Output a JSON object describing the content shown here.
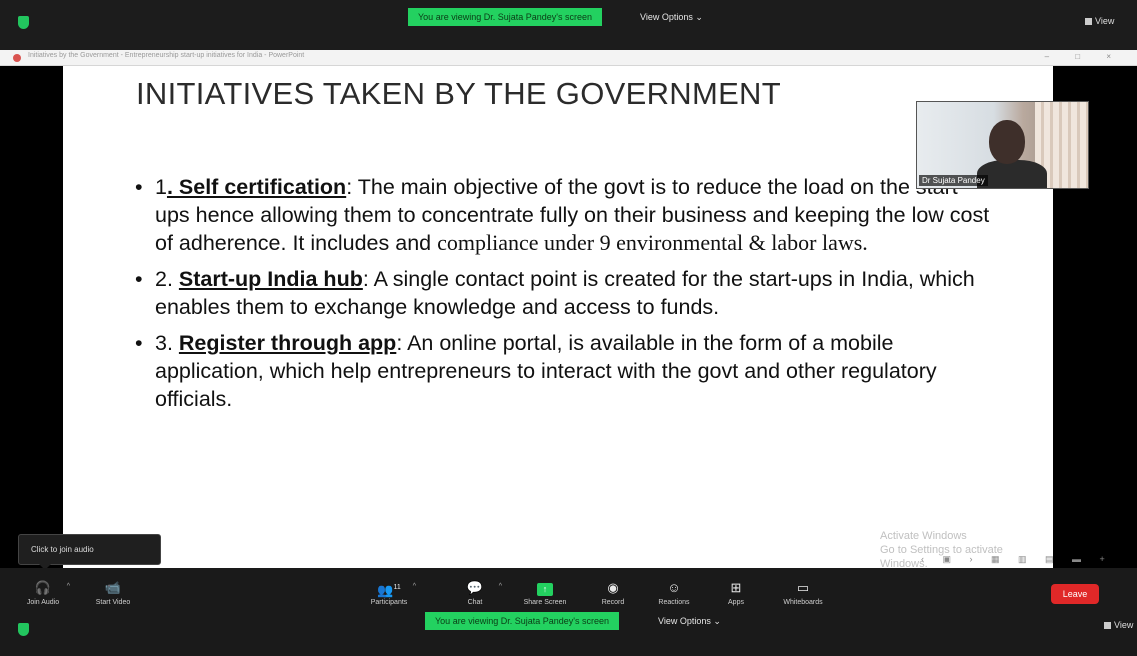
{
  "colors": {
    "accent_green": "#23d160",
    "leave_red": "#e02828",
    "toolbar_bg": "#1a1a1a"
  },
  "top_bar": {
    "security_icon": "shield-icon",
    "viewing_banner": "You are viewing Dr. Sujata Pandey's screen",
    "view_options": "View Options ⌄",
    "view_button": "View"
  },
  "browser": {
    "tab_title": "Initiatives by the Government - Entrepreneurship start-up initiatives for India - PowerPoint",
    "controls": "– □ ×"
  },
  "slide": {
    "title": "INITIATIVES TAKEN BY THE GOVERNMENT",
    "bullets": [
      {
        "num": "1",
        "term": ". Self certification",
        "text": ": The main objective of the govt is to reduce the load on the start ups hence allowing them to concentrate fully on their business and keeping the low cost of adherence. It includes and",
        "text_serif": "compliance under 9 environmental & labor laws."
      },
      {
        "num": "2. ",
        "term": "Start-up India hub",
        "text": ": A single contact point is  created for the start-ups in India, which enables them to exchange knowledge and access to funds."
      },
      {
        "num": "3. ",
        "term": "Register through app",
        "text": ": An online portal, is available in the form of a mobile application, which help entrepreneurs to interact with the govt and other regulatory officials."
      }
    ],
    "watermark_line1": "Activate Windows",
    "watermark_line2": "Go to Settings to activate Windows.",
    "slide_controls": "‹ ▣ › ▦ ▥ ▤ ▬ +"
  },
  "video": {
    "participant_name": "Dr Sujata Pandey"
  },
  "tooltip": {
    "text": "Click to join audio"
  },
  "toolbar": {
    "join_audio": {
      "icon": "headphones-icon",
      "glyph": "🎧",
      "label": "Join Audio"
    },
    "start_video": {
      "icon": "video-camera-icon",
      "glyph": "📹",
      "label": "Start Video"
    },
    "participants": {
      "icon": "people-icon",
      "glyph": "👥",
      "label": "Participants",
      "count": "11"
    },
    "chat": {
      "icon": "chat-icon",
      "glyph": "💬",
      "label": "Chat"
    },
    "share_screen": {
      "icon": "share-screen-icon",
      "glyph": "↑",
      "label": "Share Screen"
    },
    "record": {
      "icon": "record-icon",
      "glyph": "◉",
      "label": "Record"
    },
    "reactions": {
      "icon": "reactions-icon",
      "glyph": "☺",
      "label": "Reactions"
    },
    "apps": {
      "icon": "apps-icon",
      "glyph": "⊞",
      "label": "Apps"
    },
    "whiteboards": {
      "icon": "whiteboard-icon",
      "glyph": "▭",
      "label": "Whiteboards"
    },
    "leave": "Leave",
    "viewing_banner": "You are viewing Dr. Sujata Pandey's screen",
    "view_options": "View Options ⌄",
    "view_button": "View"
  }
}
